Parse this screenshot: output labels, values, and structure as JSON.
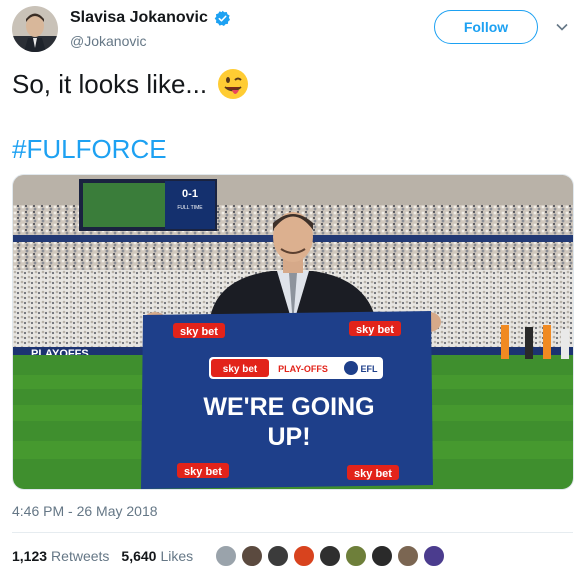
{
  "author": {
    "display_name": "Slavisa Jokanovic",
    "handle": "@Jokanovic",
    "verified": true,
    "avatar_icon": "profile-photo"
  },
  "actions": {
    "follow_label": "Follow",
    "menu_icon": "chevron-down-icon"
  },
  "tweet": {
    "text": "So, it looks like...",
    "emoji_icon": "winking-face-with-tongue-emoji",
    "hashtag": "#FULFORCE"
  },
  "photo": {
    "scoreboard_score": "0-1",
    "scoreboard_status": "FULL TIME",
    "flag_brand": "sky bet",
    "flag_sub_brand": "PLAY-OFFS",
    "flag_efl": "EFL",
    "flag_headline_line1": "WE'RE GOING",
    "flag_headline_line2": "UP!",
    "hoarding_text": "PLAYOFFS"
  },
  "meta": {
    "timestamp": "4:46 PM - 26 May 2018",
    "retweets_count": "1,123",
    "retweets_label": "Retweets",
    "likes_count": "5,640",
    "likes_label": "Likes"
  },
  "likers": [
    {
      "color": "#9aa3ab"
    },
    {
      "color": "#5b4a3f"
    },
    {
      "color": "#3b3b3b"
    },
    {
      "color": "#d8431e"
    },
    {
      "color": "#2f2f2f"
    },
    {
      "color": "#6e7f3a"
    },
    {
      "color": "#2a2a2a"
    },
    {
      "color": "#7b6652"
    },
    {
      "color": "#4b3c8e"
    }
  ],
  "colors": {
    "accent": "#1da1f2",
    "flag_blue": "#1e3f8a",
    "skybet_red": "#e2231a",
    "pitch_green": "#3f8f2e"
  }
}
